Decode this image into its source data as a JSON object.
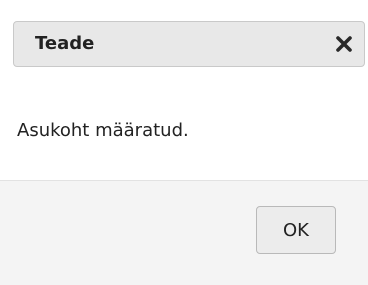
{
  "dialog": {
    "title": "Teade",
    "message": "Asukoht määratud.",
    "ok_label": "OK",
    "close_icon": "close-icon"
  },
  "colors": {
    "titlebar_bg": "#e8e8e8",
    "titlebar_border": "#c9c9c9",
    "buttonpane_bg": "#f4f4f4",
    "text": "#222222"
  }
}
